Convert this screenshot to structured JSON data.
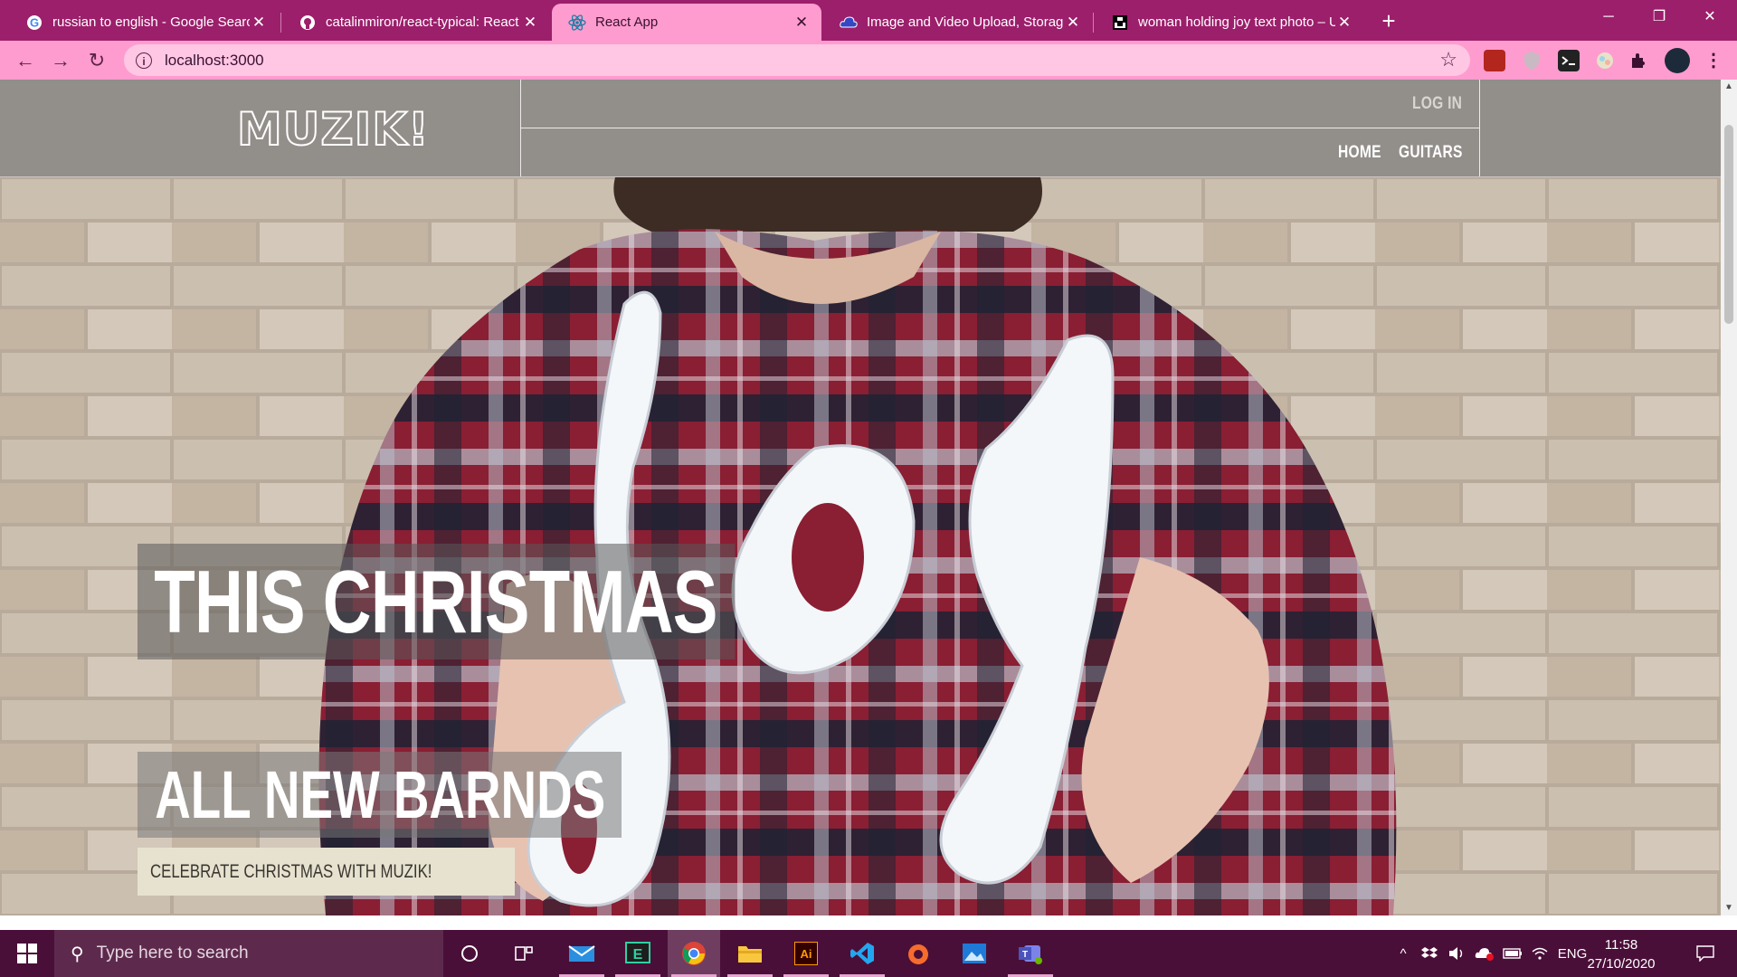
{
  "browser": {
    "tabs": [
      {
        "title": "russian to english - Google Search",
        "icon": "google-icon",
        "active": false
      },
      {
        "title": "catalinmiron/react-typical: React",
        "icon": "github-icon",
        "active": false
      },
      {
        "title": "React App",
        "icon": "react-icon",
        "active": true
      },
      {
        "title": "Image and Video Upload, Storage",
        "icon": "cloudinary-icon",
        "active": false
      },
      {
        "title": "woman holding joy text photo – Unsplash",
        "icon": "unsplash-icon",
        "active": false
      }
    ],
    "new_tab": "+",
    "url": "localhost:3000",
    "window_controls": {
      "minimize": "─",
      "restore": "❐",
      "close": "✕"
    }
  },
  "site": {
    "logo": "MUZIK!",
    "nav": {
      "login": "LOG IN",
      "home": "HOME",
      "guitars": "GUITARS"
    },
    "hero": {
      "title": "THIS CHRISTMAS",
      "subtitle": "ALL NEW BARNDS",
      "cta": "CELEBRATE CHRISTMAS WITH MUZIK!",
      "image_text": "joy"
    }
  },
  "taskbar": {
    "search_placeholder": "Type here to search",
    "language": "ENG",
    "time": "11:58",
    "date": "27/10/2020"
  },
  "colors": {
    "tabstrip": "#9c1f6b",
    "toolbar": "#ff9ccf",
    "header": "#928e8a",
    "taskbar": "#4a0f38",
    "cta_bg": "#e6e2cf"
  }
}
